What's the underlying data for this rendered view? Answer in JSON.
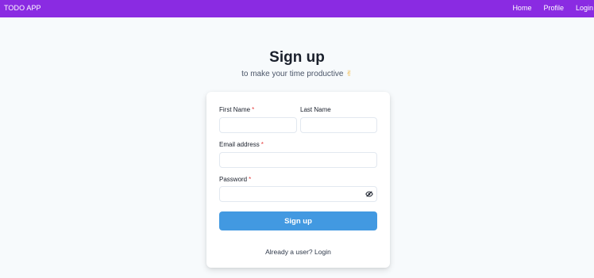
{
  "nav": {
    "brand": "TODO APP",
    "links": [
      "Home",
      "Profile",
      "Login"
    ]
  },
  "header": {
    "title": "Sign up",
    "subtitle": "to make your time productive",
    "subtitle_icon": "victory-hand-icon"
  },
  "form": {
    "first_name_label": "First Name",
    "last_name_label": "Last Name",
    "email_label": "Email address",
    "password_label": "Password",
    "required_marker": "*",
    "first_name_value": "",
    "last_name_value": "",
    "email_value": "",
    "password_value": "",
    "password_toggle_icon": "eye-slash-icon",
    "submit_label": "Sign up",
    "footer_prefix": "Already a user?",
    "footer_link": "Login"
  },
  "colors": {
    "navbar": "#8a2be2",
    "primary_button": "#4299e1",
    "required": "#e53e3e",
    "page_background": "#f7fafc"
  }
}
